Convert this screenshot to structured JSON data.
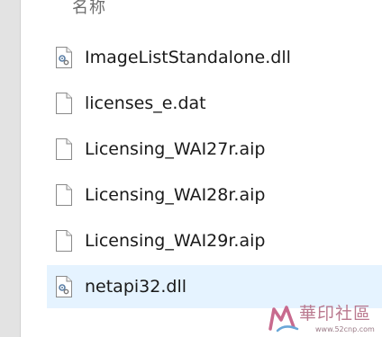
{
  "header": {
    "column_name": "名称"
  },
  "files": [
    {
      "name": "ImageListStandalone.dll",
      "icon": "dll-file-icon",
      "selected": false
    },
    {
      "name": "licenses_e.dat",
      "icon": "blank-file-icon",
      "selected": false
    },
    {
      "name": "Licensing_WAI27r.aip",
      "icon": "blank-file-icon",
      "selected": false
    },
    {
      "name": "Licensing_WAI28r.aip",
      "icon": "blank-file-icon",
      "selected": false
    },
    {
      "name": "Licensing_WAI29r.aip",
      "icon": "blank-file-icon",
      "selected": false
    },
    {
      "name": "netapi32.dll",
      "icon": "dll-file-icon",
      "selected": true
    }
  ],
  "watermark": {
    "text": "華印社區",
    "url": "www.52cnp.com"
  },
  "colors": {
    "selection": "#e5f3ff",
    "header_text": "#6d6d6d",
    "file_text": "#1a1a1a",
    "watermark": "#b36b83"
  }
}
